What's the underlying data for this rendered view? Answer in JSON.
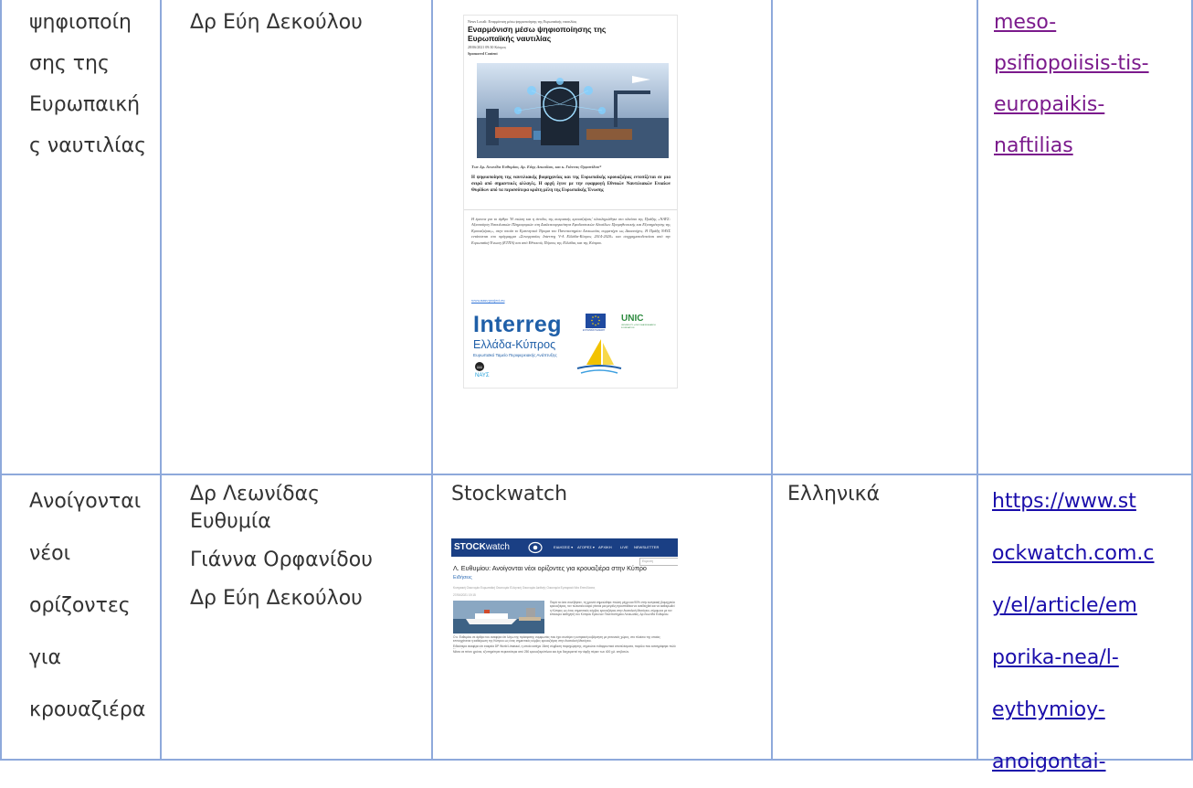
{
  "row1": {
    "title_lines": [
      "ψηφιοποίη",
      "σης της",
      "Ευρωπαική",
      "ς ναυτιλίας"
    ],
    "author": "Δρ Εύη Δεκούλου",
    "source": "",
    "language": "",
    "link_lines": [
      "meso-",
      "psifiopoiisis-tis-",
      "europaikis-",
      "naftilias"
    ],
    "thumb": {
      "kicker": "News Locali: Εναρμόνιση μέσω ψηφιοποίησης της Ευρωπαϊκής ναυτιλίας",
      "headline1": "Εναρμόνιση μέσω ψηφιοποίησης της",
      "headline2": "Ευρωπαϊκής ναυτιλίας",
      "meta": "28/06/2021 09:30 Κόσμος",
      "sponsored": "Sponsored Content",
      "byline": "Των Δρ. Λεωνίδα Ευθυμίου, Δρ. Εύης Δεκούλου, και κ. Γιάννας Ορφανίδου*",
      "lead": "Η ψηφιοποίηση της ναυτιλιακής βιομηχανίας και της Ευρωπαϊκής κρουαζιέρας εντοπίζεται σε μια σειρά από σημαντικές αλλαγές. Η αρχή έγινε με την εφαρμογή Εθνικών Ναυτιλιακών Ενιαίων Θυρίδων από τα περισσότερα κράτη μέλη της Ευρωπαϊκής Ένωσης",
      "note": "Η έρευνα για το άρθρο 'Η πτώση και η άνοδος της κυπριακής κρουαζιέρας' ολοκληρώθηκε στο πλαίσιο της Πράξης «ΝΑΥΣ: Αξιοποίηση Ναυτιλιακών Πληροφοριών στη Διαλειτουργικότητα Εφοδιαστικών Αλυσίδων Προμηθευτικής και Εξυπηρέτησης της Κρουαζιέρας», στην οποία το Ερευνητικό Ίδρυμα του Πανεπιστημίου Λευκωσίας συμμετέχει ως Δικαιούχος. Η Πράξη ΝΑΥΣ εντάσσεται στο πρόγραμμα «Συνεργασίας Interreg V-A Ελλάδα-Κύπρος 2014-2020» και συγχρηματοδοτείται από την Ευρωπαϊκή Ένωση (ΕΤΠΑ) και από Εθνικούς Πόρους της Ελλάδας και της Κύπρου.",
      "note_link": "www.naus-project.eu",
      "interreg": "Interreg",
      "country": "Ελλάδα-Κύπρος",
      "fund": "Ευρωπαϊκό Ταμείο Περιφερειακής Ανάπτυξης",
      "eu_caption": "ΕΥΡΩΠΑΪΚΗ ΕΝΩΣΗ",
      "unic": "UNIC",
      "unic_sub": "UNIVERSITY of NICOSIA RESEARCH FOUNDATION",
      "naus": "ΝΑΥΣ"
    }
  },
  "row2": {
    "title_lines": [
      "Ανοίγονται",
      "νέοι",
      "ορίζοντες",
      "για",
      "κρουαζιέρα"
    ],
    "authors": [
      "Δρ Λεωνίδας",
      "Ευθυμία",
      "Γιάννα Ορφανίδου",
      "Δρ Εύη Δεκούλου"
    ],
    "source": "Stockwatch",
    "language": "Ελληνικά",
    "link_lines": [
      "https://www.st",
      "ockwatch.com.c",
      "y/el/article/em",
      "porika-nea/l-",
      "eythymioy-",
      "anoigontai-"
    ],
    "thumb": {
      "logo_a": "STOCK",
      "logo_b": "watch",
      "nav": [
        "ΕΙΔΗΣΕΙΣ ▾",
        "ΑΓΟΡΕΣ ▾",
        "ΑΡΧΙΚΗ",
        "LIVE",
        "NEWSLETTER"
      ],
      "search": "Εύρεση",
      "headline": "Λ. Ευθυμίου: Ανοίγονται νέοι ορίζοντες για κρουαζιέρα στην Κύπρο",
      "section": "Ειδήσεις",
      "tags": "Κυπριακή Οικονομία   Ευρωπαϊκή Οικονομία   Ελληνική Οικονομία   Διεθνής Οικονομία   Εμπορικά Νέα   Επενδύσεις",
      "date": "27/06/2021 19:15",
      "p1": "Παρά τα όσα συνέβησαν, τη χρονιά σημειώθηκε πτώση μέχρι και 90% στην κυπριακή βιομηχανία κρουαζιέρας, τον τελευταίο καιρό γίνεται μια μεγάλη προσπάθεια να αναδειχθεί και να καθιερωθεί η Κύπρος ως ένας σημαντικός κόμβος κρουαζιέρας στην Ανατολική Μεσόγειο, σύμφωνα με τον επίκουρο καθηγητή του Κύπρου Ερευνών Πανεπιστημίου Λευκωσίας, Δρ Λεωνίδα Ευθυμίου.",
      "p2": "Ο κ. Ευθυμίου σε άρθρο του αναφέρει ότι λόγω της πρόσφατης συμφωνίας που έχει συνάψει η κυπριακή κυβέρνηση με γειτονικές χώρες, στο πλαίσιο της οποίας επιτυγχάνεται η καθιέρωση της Κύπρου ως ένας σημαντικός κόμβος κρουαζιέρας στην Ανατολική Μεσόγειο.",
      "p3": "Ειδικότερα αναφέρει ότι εταιρεία DP World Limassol, η οποία κατέχει 15ετή σύμβαση παραχώρησης, σημειώνει ενθαρρυντικά αποτελέσματα, παρόλο που καταγράφηκε πολύ δύσκολη η οικονομική κρίση.",
      "p4": "Μέσα σε πέντε χρόνια, εξυπηρέτησε περισσότερα από 250 κρουαζιερόπλοια και έχει διαχειριστεί την άφιξη πέραν των 400 χιλ. επιβατών.",
      "p5": "Εξηγώντας τα όσα που έχουν γίνει στο λιμάνι Λεμεσού, ο κ. Ευθυμίου σημειώνει ότι γενικότερα ο τομέας της κρουαζιέρας"
    }
  },
  "colors": {
    "border": "#8ea9db",
    "link": "#1a0dab",
    "visited": "#7b1a8c",
    "stock_blue": "#1a3f84",
    "interreg_blue": "#1f5fa8"
  }
}
